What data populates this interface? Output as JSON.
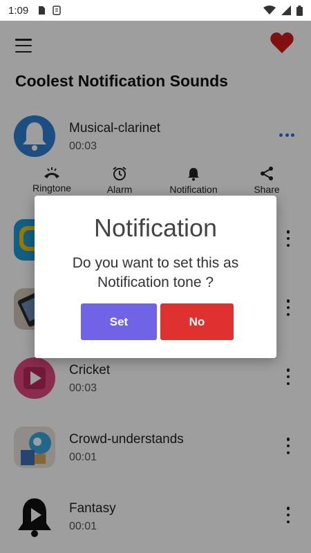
{
  "status_bar": {
    "time": "1:09"
  },
  "header": {
    "title": "Coolest Notification Sounds"
  },
  "list": [
    {
      "name": "Musical-clarinet",
      "duration": "00:03"
    },
    {
      "name": "",
      "duration": ""
    },
    {
      "name": "",
      "duration": ""
    },
    {
      "name": "Cricket",
      "duration": "00:03"
    },
    {
      "name": "Crowd-understands",
      "duration": "00:01"
    },
    {
      "name": "Fantasy",
      "duration": "00:01"
    }
  ],
  "actions": {
    "ringtone": "Ringtone",
    "alarm": "Alarm",
    "notification": "Notification",
    "share": "Share"
  },
  "dialog": {
    "title": "Notification",
    "message": "Do you want to set this as Notification tone ?",
    "set_label": "Set",
    "no_label": "No"
  },
  "colors": {
    "set_button": "#7163e6",
    "no_button": "#e03131",
    "heart": "#d01a1a",
    "accent_dots": "#2f6fd6"
  }
}
